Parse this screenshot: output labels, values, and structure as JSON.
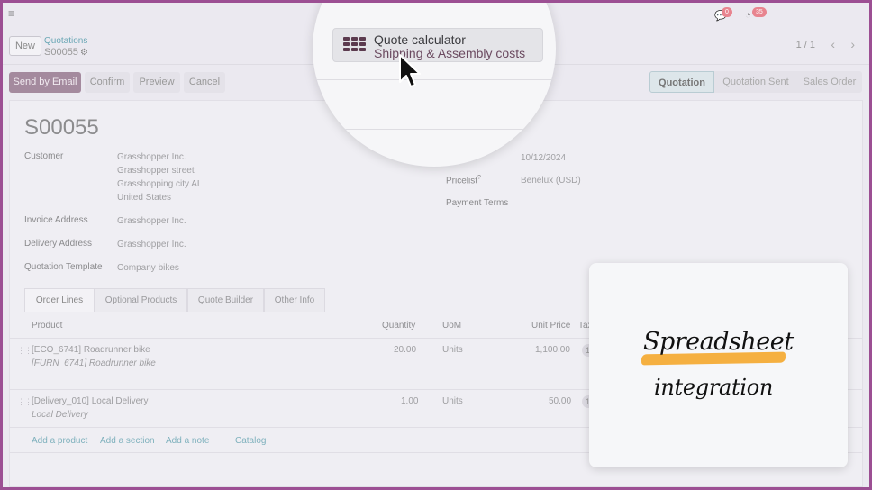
{
  "topbar": {
    "menu_icon": "hamburger-icon",
    "messages_badge": "0",
    "activities_badge": "35"
  },
  "control_panel": {
    "new_label": "New",
    "breadcrumb_parent": "Quotations",
    "breadcrumb_current": "S00055",
    "pager": "1 / 1",
    "pager_prev": "‹",
    "pager_next": "›",
    "actions": [
      "Send by Email",
      "Confirm",
      "Preview",
      "Cancel"
    ],
    "stages": [
      "Quotation",
      "Quotation Sent",
      "Sales Order"
    ],
    "active_stage": "Quotation"
  },
  "form": {
    "title": "S00055",
    "customer_label": "Customer",
    "customer_lines": [
      "Grasshopper Inc.",
      "Grasshopper street",
      "Grasshopping city AL",
      "United States"
    ],
    "invoice_label": "Invoice Address",
    "invoice_value": "Grasshopper Inc.",
    "delivery_label": "Delivery Address",
    "delivery_value": "Grasshopper Inc.",
    "template_label": "Quotation Template",
    "template_value": "Company bikes",
    "expiration_date": "10/12/2024",
    "pricelist_label": "Pricelist",
    "pricelist_value": "Benelux (USD)",
    "payment_terms_label": "Payment Terms"
  },
  "tabs": [
    "Order Lines",
    "Optional Products",
    "Quote Builder",
    "Other Info"
  ],
  "order_lines": {
    "columns": [
      "Product",
      "Quantity",
      "UoM",
      "Unit Price",
      "Tax"
    ],
    "rows": [
      {
        "product": "[ECO_6741] Roadrunner bike",
        "description": "[FURN_6741] Roadrunner bike",
        "quantity": "20.00",
        "uom": "Units",
        "unit_price": "1,100.00",
        "tax": "1"
      },
      {
        "product": "[Delivery_010] Local Delivery",
        "description": "Local Delivery",
        "quantity": "1.00",
        "uom": "Units",
        "unit_price": "50.00",
        "tax": "1"
      }
    ],
    "add_links": [
      "Add a product",
      "Add a section",
      "Add a note",
      "Catalog"
    ]
  },
  "magnifier": {
    "button_title": "Quote calculator",
    "button_subtitle": "Shipping & Assembly costs"
  },
  "overlay_card": {
    "line1": "Spreadsheet",
    "line2": "integration",
    "highlight_color": "#f5b041"
  }
}
